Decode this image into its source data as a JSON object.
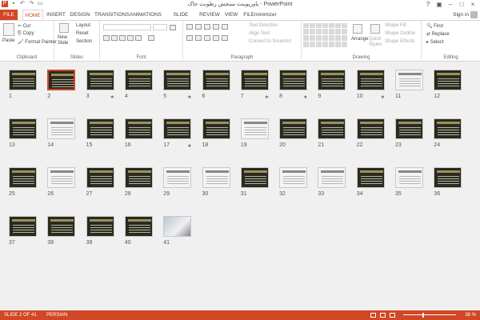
{
  "window": {
    "title": "پاورپوینت سنجش رطوبت خاک - PowerPoint",
    "signin": "Sign in"
  },
  "tabs": [
    "FILE",
    "HOME",
    "INSERT",
    "DESIGN",
    "TRANSITIONS",
    "ANIMATIONS",
    "SLIDE SHOW",
    "REVIEW",
    "VIEW",
    "FILEminimizer"
  ],
  "ribbon": {
    "clipboard": {
      "label": "Clipboard",
      "paste": "Paste",
      "cut": "Cut",
      "copy": "Copy",
      "format_painter": "Format Painter"
    },
    "slides": {
      "label": "Slides",
      "new_slide": "New Slide",
      "layout": "Layout",
      "reset": "Reset",
      "section": "Section"
    },
    "font": {
      "label": "Font"
    },
    "paragraph": {
      "label": "Paragraph",
      "text_direction": "Text Direction",
      "align_text": "Align Text",
      "convert": "Convert to SmartArt"
    },
    "drawing": {
      "label": "Drawing",
      "arrange": "Arrange",
      "quick_styles": "Quick Styles",
      "shape_fill": "Shape Fill",
      "shape_outline": "Shape Outline",
      "shape_effects": "Shape Effects"
    },
    "editing": {
      "label": "Editing",
      "find": "Find",
      "replace": "Replace",
      "select": "Select"
    }
  },
  "slides": [
    {
      "n": "1",
      "t": "dark",
      "star": false
    },
    {
      "n": "2",
      "t": "dark",
      "star": false,
      "selected": true
    },
    {
      "n": "3",
      "t": "dark",
      "star": true
    },
    {
      "n": "4",
      "t": "dark",
      "star": false
    },
    {
      "n": "5",
      "t": "dark",
      "star": true
    },
    {
      "n": "6",
      "t": "dark",
      "star": false
    },
    {
      "n": "7",
      "t": "dark",
      "star": true
    },
    {
      "n": "8",
      "t": "dark",
      "star": true
    },
    {
      "n": "9",
      "t": "dark",
      "star": false
    },
    {
      "n": "10",
      "t": "dark",
      "star": true
    },
    {
      "n": "11",
      "t": "light",
      "star": false
    },
    {
      "n": "12",
      "t": "dark",
      "star": false
    },
    {
      "n": "13",
      "t": "dark",
      "star": false
    },
    {
      "n": "14",
      "t": "light",
      "star": false
    },
    {
      "n": "15",
      "t": "dark",
      "star": false
    },
    {
      "n": "16",
      "t": "dark",
      "star": false
    },
    {
      "n": "17",
      "t": "dark",
      "star": true
    },
    {
      "n": "18",
      "t": "dark",
      "star": false
    },
    {
      "n": "19",
      "t": "light",
      "star": false
    },
    {
      "n": "20",
      "t": "dark",
      "star": false
    },
    {
      "n": "21",
      "t": "dark",
      "star": false
    },
    {
      "n": "22",
      "t": "dark",
      "star": false
    },
    {
      "n": "23",
      "t": "dark",
      "star": false
    },
    {
      "n": "24",
      "t": "dark",
      "star": false
    },
    {
      "n": "25",
      "t": "dark",
      "star": false
    },
    {
      "n": "26",
      "t": "light",
      "star": false
    },
    {
      "n": "27",
      "t": "dark",
      "star": false
    },
    {
      "n": "28",
      "t": "dark",
      "star": false
    },
    {
      "n": "29",
      "t": "light",
      "star": false
    },
    {
      "n": "30",
      "t": "light",
      "star": false
    },
    {
      "n": "31",
      "t": "dark",
      "star": false
    },
    {
      "n": "32",
      "t": "light",
      "star": false
    },
    {
      "n": "33",
      "t": "light",
      "star": false
    },
    {
      "n": "34",
      "t": "dark",
      "star": false
    },
    {
      "n": "35",
      "t": "light",
      "star": false
    },
    {
      "n": "36",
      "t": "dark",
      "star": false
    },
    {
      "n": "37",
      "t": "dark",
      "star": false
    },
    {
      "n": "38",
      "t": "dark",
      "star": false
    },
    {
      "n": "39",
      "t": "dark",
      "star": false
    },
    {
      "n": "40",
      "t": "dark",
      "star": false
    },
    {
      "n": "41",
      "t": "photo",
      "star": false
    }
  ],
  "status": {
    "slide": "SLIDE 2 OF 41",
    "language": "PERSIAN",
    "zoom": "38 %"
  },
  "colors": {
    "accent": "#d24726",
    "slide_dark": "#2a2a1e",
    "selected_border": "#d24726"
  }
}
